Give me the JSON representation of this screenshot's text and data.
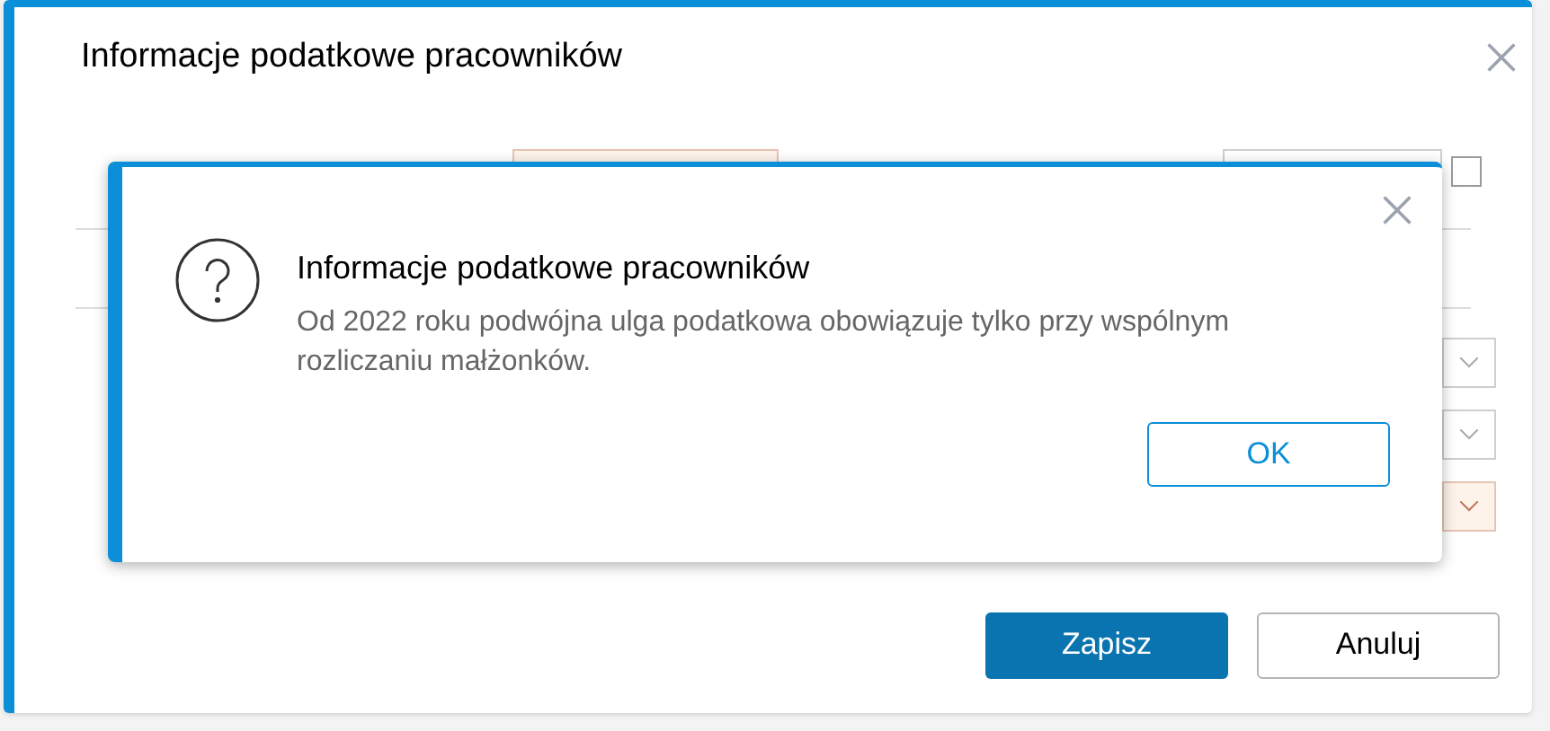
{
  "dialog": {
    "title": "Informacje podatkowe pracowników",
    "form": {
      "checkbox": {
        "checked": false
      }
    },
    "buttons": [
      {
        "label": "Zapisz",
        "kind": "primary"
      },
      {
        "label": "Anuluj",
        "kind": "secondary"
      }
    ]
  },
  "message_box": {
    "title": "Informacje podatkowe pracowników",
    "message": "Od 2022 roku podwójna ulga podatkowa obowiązuje tylko przy wspólnym rozliczaniu małżonków.",
    "button": "OK"
  }
}
